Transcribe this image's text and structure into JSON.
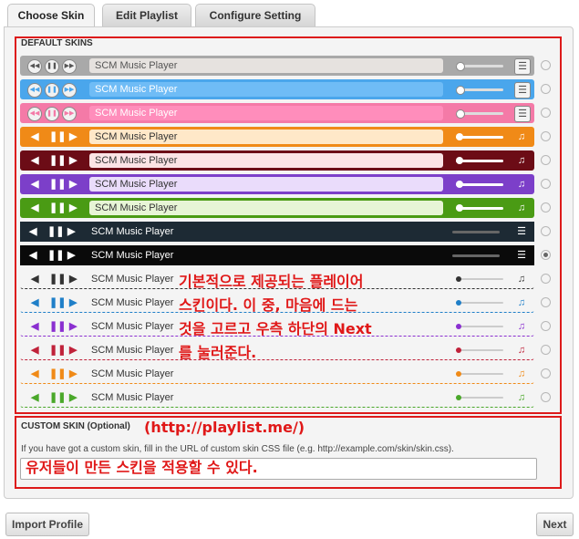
{
  "tabs": [
    "Choose Skin",
    "Edit Playlist",
    "Configure Setting"
  ],
  "default_skins_title": "DEFAULT SKINS",
  "player_title": "SCM Music Player",
  "skins": [
    {
      "id": "gray-glossy",
      "style": "round",
      "bg": "#a9a9a9",
      "box": "#e6e2df",
      "text": "#555",
      "checked": false
    },
    {
      "id": "blue-glossy",
      "style": "round",
      "bg": "#4aa6ec",
      "box": "#6fbcf6",
      "text": "#ffffff",
      "checked": false
    },
    {
      "id": "pink-glossy",
      "style": "round",
      "bg": "#f47aa7",
      "box": "#ff8dbb",
      "text": "#ffffff",
      "checked": false
    },
    {
      "id": "orange",
      "style": "solid",
      "bg": "#f08a17",
      "box": "#ffe8c8",
      "text": "#333",
      "ctrl": "#ffffff",
      "checked": false
    },
    {
      "id": "maroon",
      "style": "solid",
      "bg": "#6c0c16",
      "box": "#fbe3e5",
      "text": "#333",
      "ctrl": "#ffffff",
      "checked": false
    },
    {
      "id": "purple",
      "style": "solid",
      "bg": "#7c3fc9",
      "box": "#eadcfb",
      "text": "#333",
      "ctrl": "#ffffff",
      "checked": false
    },
    {
      "id": "green",
      "style": "solid",
      "bg": "#4a9b14",
      "box": "#e7f5d6",
      "text": "#333",
      "ctrl": "#ffffff",
      "checked": false
    },
    {
      "id": "black-glass",
      "style": "dark",
      "bg": "#1d2a34",
      "text": "#ffffff",
      "ctrl": "#ffffff",
      "checked": false
    },
    {
      "id": "black",
      "style": "dark",
      "bg": "#0a0a0a",
      "text": "#ffffff",
      "ctrl": "#ffffff",
      "checked": true
    },
    {
      "id": "simple-black",
      "style": "simple",
      "accent": "#333333",
      "checked": false
    },
    {
      "id": "simple-blue",
      "style": "simple",
      "accent": "#1f7fc8",
      "checked": false
    },
    {
      "id": "simple-purple",
      "style": "simple",
      "accent": "#8a2fd0",
      "checked": false
    },
    {
      "id": "simple-red",
      "style": "simple",
      "accent": "#c0223a",
      "checked": false
    },
    {
      "id": "simple-orange",
      "style": "simple",
      "accent": "#f08a17",
      "checked": false
    },
    {
      "id": "simple-green",
      "style": "simple",
      "accent": "#4aa82a",
      "checked": false
    }
  ],
  "annotation_skins": [
    "기본적으로 제공되는 플레이어",
    "스킨이다. 이 중, 마음에 드는",
    "것을 고르고 우측 하단의 Next",
    "를 눌러준다."
  ],
  "custom": {
    "label": "CUSTOM SKIN (Optional)",
    "annotation_url": "(http://playlist.me/)",
    "help": "If you have got a custom skin, fill in the URL of custom skin CSS file (e.g. http://example.com/skin/skin.css).",
    "annotation_input": "유저들이 만든 스킨을 적용할 수 있다.",
    "value": ""
  },
  "buttons": {
    "import": "Import Profile",
    "next": "Next"
  },
  "colors": {
    "annotation": "#e01818"
  }
}
